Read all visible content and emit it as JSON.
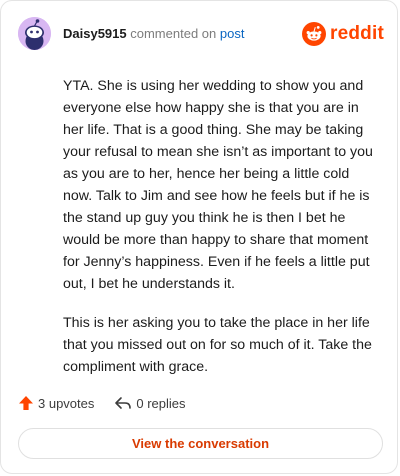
{
  "header": {
    "username": "Daisy5915",
    "verb": "commented on",
    "post_link": "post",
    "brand": "reddit"
  },
  "comment": {
    "paragraphs": [
      "YTA. She is using her wedding to show you and everyone else how happy she is that you are in her life. That is a good thing. She may be taking your refusal to mean she isn’t as important to you as you are to her, hence her being a little cold now. Talk to Jim and see how he feels but if he is the stand up guy you think he is then I bet he would be more than happy to share that moment for Jenny’s happiness. Even if he feels a little put out, I bet he understands it.",
      "This is her asking you to take the place in her life that you missed out on for so much of it. Take the compliment with grace."
    ]
  },
  "actions": {
    "upvotes": "3 upvotes",
    "replies": "0 replies"
  },
  "cta": {
    "label": "View the conversation"
  },
  "colors": {
    "brand": "#ff4500",
    "link": "#0a66c2",
    "cta": "#d93a00",
    "avatar_bg": "#d8b7f2"
  }
}
